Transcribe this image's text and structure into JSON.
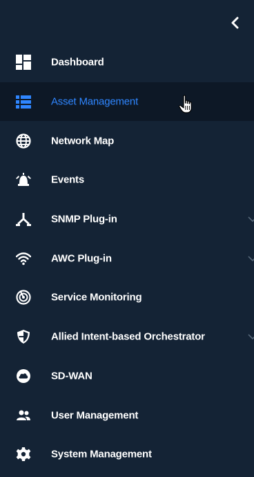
{
  "sidebar": {
    "collapse_icon": "chevron-left-icon",
    "active_color": "#2f86ff",
    "background": "#142335",
    "items": [
      {
        "label": "Dashboard",
        "icon": "dashboard-icon"
      },
      {
        "label": "Asset Management",
        "icon": "list-icon",
        "active": true
      },
      {
        "label": "Network Map",
        "icon": "globe-icon"
      },
      {
        "label": "Events",
        "icon": "alarm-icon"
      },
      {
        "label": "SNMP Plug-in",
        "icon": "snmp-icon",
        "expandable": true
      },
      {
        "label": "AWC Plug-in",
        "icon": "wifi-icon",
        "expandable": true
      },
      {
        "label": "Service Monitoring",
        "icon": "monitoring-icon"
      },
      {
        "label": "Allied Intent-based Orchestrator",
        "icon": "shield-icon",
        "expandable": true
      },
      {
        "label": "SD-WAN",
        "icon": "cloud-icon"
      },
      {
        "label": "User Management",
        "icon": "users-icon"
      },
      {
        "label": "System Management",
        "icon": "gear-icon"
      }
    ]
  }
}
